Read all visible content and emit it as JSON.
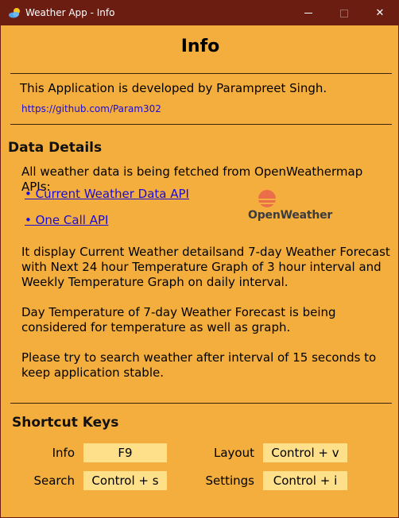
{
  "window": {
    "title": "Weather App - Info",
    "controls": {
      "minimize": "minimize",
      "maximize": "maximize",
      "close": "✕"
    }
  },
  "info": {
    "heading": "Info",
    "developer_text": "This Application is developed by Parampreet Singh.",
    "github_link": "https://github.com/Param302"
  },
  "data_details": {
    "title": "Data Details",
    "intro": "All weather data is being fetched from OpenWeathermap APIs:",
    "links": [
      {
        "label": "• Current Weather Data API"
      },
      {
        "label": "• One Call API"
      }
    ],
    "logo_text": "OpenWeather",
    "paragraph1_line1": "It display Current Weather detailsand 7-day Weather Forecast",
    "paragraph1_line2": "with Next 24 hour Temperature Graph of 3 hour interval and",
    "paragraph1_line3": "Weekly Temperature Graph on daily interval.",
    "paragraph2_line1": "Day Temperature of 7-day Weather Forecast is being",
    "paragraph2_line2": "considered for temperature as well as graph.",
    "paragraph3_line1": "Please try to search weather after interval of 15 seconds to",
    "paragraph3_line2": "keep application stable."
  },
  "shortcuts": {
    "title": "Shortcut Keys",
    "items": [
      {
        "label": "Info",
        "keys": "F9"
      },
      {
        "label": "Layout",
        "keys": "Control + v"
      },
      {
        "label": "Search",
        "keys": "Control + s"
      },
      {
        "label": "Settings",
        "keys": "Control + i"
      }
    ]
  },
  "colors": {
    "background": "#f4ae3d",
    "titlebar": "#6b1d12",
    "link": "#1a0bd6",
    "key_box": "#fde089",
    "logo_orange": "#eb6e4b"
  }
}
